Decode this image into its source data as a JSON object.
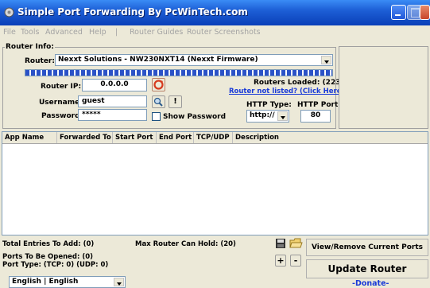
{
  "window": {
    "title": "Simple Port Forwarding By PcWinTech.com"
  },
  "menu": [
    "File",
    "Tools",
    "Advanced",
    "Help",
    "|",
    "Router Guides",
    "Router Screenshots"
  ],
  "router_info": {
    "legend": "Router Info:",
    "router_label": "Router:",
    "router_value": "Nexxt Solutions - NW230NXT14 (Nexxt Firmware)",
    "ip_label": "Router IP:",
    "ip_value": "0.0.0.0",
    "routers_loaded": "Routers Loaded: (223)",
    "router_not_listed": "Router not listed? (Click Here)",
    "username_label": "Username:",
    "username_value": "guest",
    "info_button": "!",
    "password_label": "Password:",
    "password_value": "*****",
    "show_password": "Show Password",
    "http_type_label": "HTTP Type:",
    "http_type_value": "http://",
    "http_port_label": "HTTP Port:",
    "http_port_value": "80",
    "load_progress": 1.0
  },
  "table": {
    "columns": [
      "App Name",
      "Forwarded To",
      "Start Port",
      "End Port",
      "TCP/UDP",
      "Description"
    ]
  },
  "bottom": {
    "total_entries": "Total Entries To Add: (0)",
    "max_router": "Max Router Can Hold: (20)",
    "ports_opened": "Ports To Be Opened: (0)",
    "port_type": "Port Type: (TCP: 0) (UDP: 0)",
    "plus": "+",
    "minus": "-",
    "view_remove": "View/Remove Current Ports",
    "update_router": "Update Router",
    "donate": "-Donate-",
    "language": "English | English"
  },
  "colors": {
    "titlebar": "#0a3fb8",
    "link": "#1a3bd8",
    "donate": "#1a3bd8"
  }
}
